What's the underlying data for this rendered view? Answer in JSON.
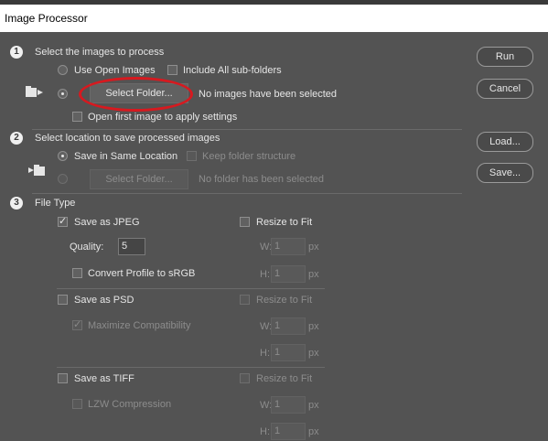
{
  "window": {
    "title": "Image Processor"
  },
  "buttons": {
    "run": "Run",
    "cancel": "Cancel",
    "load": "Load...",
    "save": "Save..."
  },
  "section1": {
    "number": "1",
    "heading": "Select the images to process",
    "use_open_images": "Use Open Images",
    "include_subfolders": "Include All sub-folders",
    "select_folder": "Select Folder...",
    "status": "No images have been selected",
    "open_first": "Open first image to apply settings"
  },
  "section2": {
    "number": "2",
    "heading": "Select location to save processed images",
    "save_same": "Save in Same Location",
    "keep_structure": "Keep folder structure",
    "select_folder": "Select Folder...",
    "status": "No folder has been selected"
  },
  "section3": {
    "number": "3",
    "heading": "File Type",
    "jpeg": {
      "label": "Save as JPEG",
      "checked": true,
      "quality_label": "Quality:",
      "quality": "5",
      "convert": "Convert Profile to sRGB",
      "resize": "Resize to Fit",
      "w": "W:",
      "h": "H:",
      "wv": "1",
      "hv": "1",
      "unit": "px"
    },
    "psd": {
      "label": "Save as PSD",
      "maximize": "Maximize Compatibility",
      "resize": "Resize to Fit",
      "w": "W:",
      "h": "H:",
      "wv": "1",
      "hv": "1",
      "unit": "px"
    },
    "tiff": {
      "label": "Save as TIFF",
      "lzw": "LZW Compression",
      "resize": "Resize to Fit",
      "w": "W:",
      "h": "H:",
      "wv": "1",
      "hv": "1",
      "unit": "px"
    }
  },
  "colors": {
    "background": "#535353",
    "highlight": "#d7191f"
  }
}
